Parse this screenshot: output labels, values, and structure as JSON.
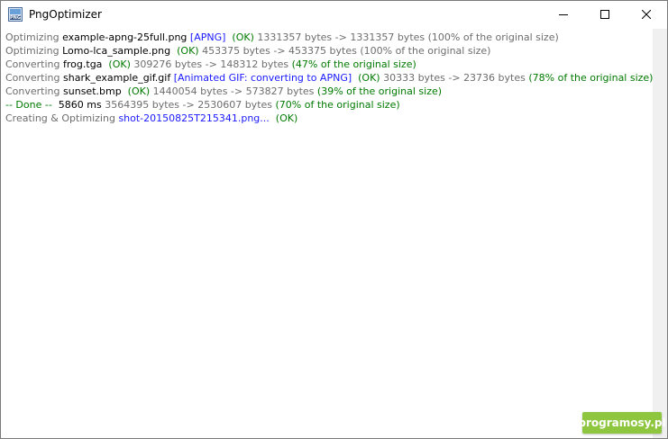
{
  "window": {
    "title": "PngOptimizer",
    "app_icon": "pngoptimizer-app-icon",
    "controls": {
      "minimize_icon": "minimize-icon",
      "maximize_icon": "maximize-icon",
      "close_icon": "close-icon"
    }
  },
  "colors": {
    "label_gray": "#6d6d6d",
    "filename_black": "#000000",
    "info_blue": "#1a1aff",
    "ok_green": "#007a00",
    "watermark_green": "#8ec63f"
  },
  "log": {
    "lines": [
      {
        "action": "Optimizing ",
        "file": "example-apng-25full.png",
        "tag": " [APNG]",
        "ok": "  (OK)",
        "stats": " 1331357 bytes -> 1331357 bytes ",
        "ratio": "(100% of the original size)",
        "ratio_color": "gray"
      },
      {
        "action": "Optimizing ",
        "file": "Lomo-lca_sample.png",
        "tag": "",
        "ok": "  (OK)",
        "stats": " 453375 bytes -> 453375 bytes ",
        "ratio": "(100% of the original size)",
        "ratio_color": "gray"
      },
      {
        "action": "Converting ",
        "file": "frog.tga",
        "tag": "",
        "ok": "  (OK)",
        "stats": " 309276 bytes -> 148312 bytes ",
        "ratio": "(47% of the original size)",
        "ratio_color": "green"
      },
      {
        "action": "Converting ",
        "file": "shark_example_gif.gif",
        "tag": " [Animated GIF: converting to APNG]",
        "ok": "  (OK)",
        "stats": " 30333 bytes -> 23736 bytes ",
        "ratio": "(78% of the original size)",
        "ratio_color": "green"
      },
      {
        "action": "Converting ",
        "file": "sunset.bmp",
        "tag": "",
        "ok": "  (OK)",
        "stats": " 1440054 bytes -> 573827 bytes ",
        "ratio": "(39% of the original size)",
        "ratio_color": "green"
      }
    ],
    "done": {
      "label": "-- Done --",
      "time": "  5860 ms",
      "stats": " 3564395 bytes -> 2530607 bytes ",
      "ratio": "(70% of the original size)"
    },
    "creating": {
      "action": "Creating & Optimizing ",
      "file": "shot-20150825T215341.png...",
      "ok": "  (OK)"
    }
  },
  "watermark": "programosy.pl"
}
